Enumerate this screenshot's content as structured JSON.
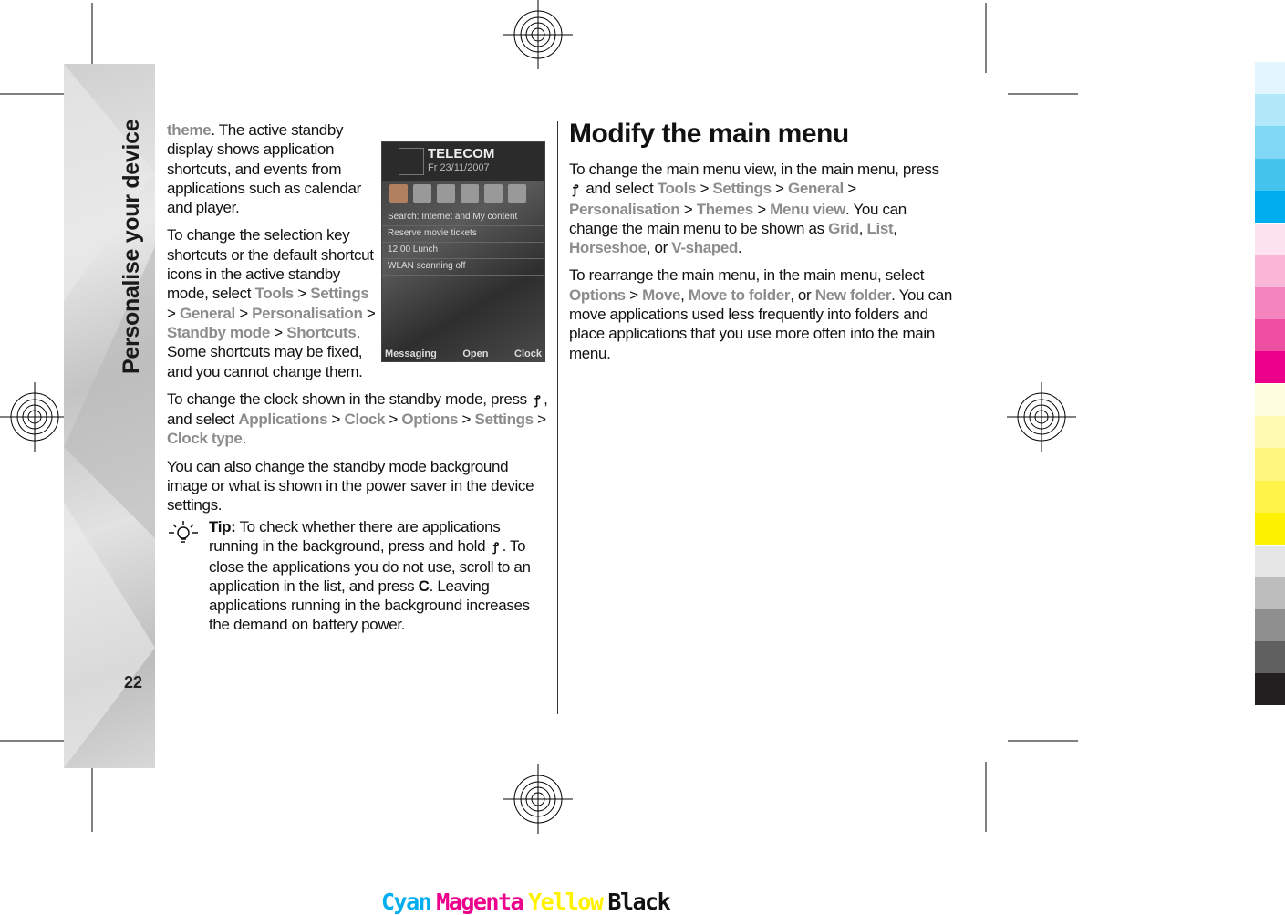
{
  "sidebar": {
    "title": "Personalise your device",
    "page_number": "22"
  },
  "left_column": {
    "paragraphs": [
      [
        {
          "t": "theme",
          "hl": true
        },
        {
          "t": ".  The active standby display shows application shortcuts, and events from applications such as calendar and player."
        }
      ],
      [
        {
          "t": "To change the selection key shortcuts or the default shortcut icons in the active standby mode, select "
        },
        {
          "t": "Tools",
          "hl": true
        },
        {
          "t": "  >  "
        },
        {
          "t": "Settings",
          "hl": true
        },
        {
          "t": "  >  "
        },
        {
          "t": "General",
          "hl": true
        },
        {
          "t": "  >  "
        },
        {
          "t": "Personalisation",
          "hl": true
        },
        {
          "t": "  >  "
        },
        {
          "t": "Standby mode",
          "hl": true
        },
        {
          "t": "  >  "
        },
        {
          "t": "Shortcuts",
          "hl": true
        },
        {
          "t": ". Some shortcuts may be fixed, and you cannot change them."
        }
      ],
      [
        {
          "t": "To change the clock shown in the standby mode, press "
        },
        {
          "key": true
        },
        {
          "t": ", and select "
        },
        {
          "t": "Applications",
          "hl": true
        },
        {
          "t": "  >  "
        },
        {
          "t": "Clock",
          "hl": true
        },
        {
          "t": "  >  "
        },
        {
          "t": "Options",
          "hl": true
        },
        {
          "t": "  >  "
        },
        {
          "t": "Settings",
          "hl": true
        },
        {
          "t": "  >  "
        },
        {
          "t": "Clock type",
          "hl": true
        },
        {
          "t": "."
        }
      ],
      [
        {
          "t": "You can also change the standby mode background image or what is shown in the power saver in the device settings."
        }
      ]
    ],
    "tip": [
      {
        "t": "Tip:",
        "b": true
      },
      {
        "t": "  To check whether there are applications running in the background, press and hold "
      },
      {
        "key": true
      },
      {
        "t": ". To close the applications you do not use, scroll to an application in the list, and press "
      },
      {
        "t": "C",
        "b": true
      },
      {
        "t": ". Leaving applications running in the background increases the demand on battery power."
      }
    ]
  },
  "phone_screen": {
    "operator": "TELECOM",
    "date": "Fr 23/11/2007",
    "rows": [
      "Search: Internet and My content",
      "Reserve movie tickets",
      "12:00 Lunch",
      "WLAN scanning off"
    ],
    "softkeys": [
      "Messaging",
      "Open",
      "Clock"
    ]
  },
  "right_column": {
    "heading": "Modify the main menu",
    "paragraphs": [
      [
        {
          "t": "To change the main menu view, in the main menu, press "
        },
        {
          "key": true
        },
        {
          "t": " and select "
        },
        {
          "t": "Tools",
          "hl": true
        },
        {
          "t": "  >  "
        },
        {
          "t": "Settings",
          "hl": true
        },
        {
          "t": "  >  "
        },
        {
          "t": "General",
          "hl": true
        },
        {
          "t": "  >  "
        },
        {
          "t": "Personalisation",
          "hl": true
        },
        {
          "t": "  >  "
        },
        {
          "t": "Themes",
          "hl": true
        },
        {
          "t": "  >  "
        },
        {
          "t": "Menu view",
          "hl": true
        },
        {
          "t": ". You can change the main menu to be shown as "
        },
        {
          "t": "Grid",
          "hl": true
        },
        {
          "t": ", "
        },
        {
          "t": "List",
          "hl": true
        },
        {
          "t": ", "
        },
        {
          "t": "Horseshoe",
          "hl": true
        },
        {
          "t": ", or "
        },
        {
          "t": "V-shaped",
          "hl": true
        },
        {
          "t": "."
        }
      ],
      [
        {
          "t": "To rearrange the main menu, in the main menu, select "
        },
        {
          "t": "Options",
          "hl": true
        },
        {
          "t": "  >  "
        },
        {
          "t": "Move",
          "hl": true
        },
        {
          "t": ", "
        },
        {
          "t": "Move to folder",
          "hl": true
        },
        {
          "t": ", or "
        },
        {
          "t": "New folder",
          "hl": true
        },
        {
          "t": ". You can move applications used less frequently into folders and place applications that you use more often into the main menu."
        }
      ]
    ]
  },
  "print_marks": {
    "labels": [
      {
        "t": "Cyan",
        "color": "#00aeef"
      },
      {
        "t": "Magenta",
        "color": "#ec008c"
      },
      {
        "t": "Yellow",
        "color": "#fff200"
      },
      {
        "t": "Black",
        "color": "#111111"
      }
    ],
    "swatches": [
      "#e3f6fd",
      "#b3e8fa",
      "#7fd6f5",
      "#45c4ee",
      "#00aeef",
      "#fde3ef",
      "#f9b6d6",
      "#f384bd",
      "#ee4fa3",
      "#ec008c",
      "#fffde0",
      "#fffab0",
      "#fff67f",
      "#fff34a",
      "#fff200",
      "#e6e6e6",
      "#bdbdbd",
      "#8f8f8f",
      "#606060",
      "#231f20"
    ]
  }
}
